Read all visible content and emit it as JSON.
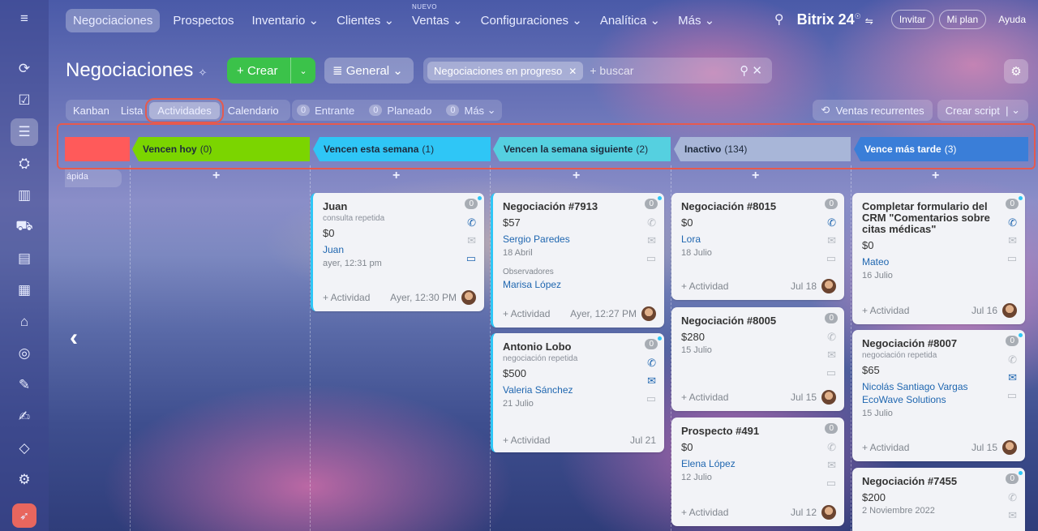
{
  "topnav": {
    "items": [
      "Negociaciones",
      "Prospectos",
      "Inventario",
      "Clientes",
      "Ventas",
      "Configuraciones",
      "Analítica",
      "Más"
    ],
    "new_badge": "NUEVO",
    "brand": "Bitrix 24",
    "invite": "Invitar",
    "my_plan": "Mi plan",
    "help": "Ayuda"
  },
  "header": {
    "title": "Negociaciones",
    "create": "Crear",
    "general": "General",
    "filter_chip": "Negociaciones en progreso",
    "search_placeholder": "buscar"
  },
  "views": {
    "kanban": "Kanban",
    "list": "Lista",
    "activities": "Actividades",
    "calendar": "Calendario"
  },
  "counters": [
    {
      "n": "0",
      "label": "Entrante"
    },
    {
      "n": "0",
      "label": "Planeado"
    },
    {
      "n": "0",
      "label": "Más"
    }
  ],
  "right_buttons": {
    "recurring": "Ventas recurrentes",
    "script": "Crear script"
  },
  "stages": [
    {
      "name": "Vencen hoy",
      "count": "(0)"
    },
    {
      "name": "Vencen esta semana",
      "count": "(1)"
    },
    {
      "name": "Vencen la semana siguiente",
      "count": "(2)"
    },
    {
      "name": "Inactivo",
      "count": "(134)"
    },
    {
      "name": "Vence más tarde",
      "count": "(3)"
    }
  ],
  "quick": "ápida",
  "colors": {
    "accent_green": "#3bc24a",
    "stage_red": "#ff5a5a",
    "stage_today": "#7bd500",
    "stage_week": "#2fc6f6",
    "stage_next": "#55d0e0",
    "stage_inactive": "#a8b6d8",
    "stage_later": "#3a7ed8",
    "highlight": "#e65a4e"
  },
  "cards": {
    "week": [
      {
        "title": "Juan",
        "sub": "consulta repetida",
        "sum": "$0",
        "contact": "Juan",
        "date": "ayer, 12:31 pm",
        "add": "+ Actividad",
        "time": "Ayer, 12:30 PM"
      }
    ],
    "next": [
      {
        "title": "Negociación #7913",
        "sum": "$57",
        "contact": "Sergio Paredes",
        "date": "18 Abril",
        "obs_label": "Observadores",
        "obs": "Marisa López",
        "add": "+ Actividad",
        "time": "Ayer, 12:27 PM"
      },
      {
        "title": "Antonio Lobo",
        "sub": "negociación repetida",
        "sum": "$500",
        "contact": "Valeria Sánchez",
        "date": "21 Julio",
        "add": "+ Actividad",
        "time": "Jul 21"
      }
    ],
    "inactive": [
      {
        "title": "Negociación #8015",
        "sum": "$0",
        "contact": "Lora",
        "date": "18 Julio",
        "add": "+ Actividad",
        "time": "Jul 18"
      },
      {
        "title": "Negociación #8005",
        "sum": "$280",
        "date": "15 Julio",
        "add": "+ Actividad",
        "time": "Jul 15"
      },
      {
        "title": "Prospecto #491",
        "sum": "$0",
        "contact": "Elena López",
        "date": "12 Julio",
        "add": "+ Actividad",
        "time": "Jul 12"
      }
    ],
    "later": [
      {
        "title": "Completar formulario del CRM \"Comentarios sobre citas médicas\"",
        "sum": "$0",
        "contact": "Mateo",
        "date": "16 Julio",
        "add": "+ Actividad",
        "time": "Jul 16"
      },
      {
        "title": "Negociación #8007",
        "sub": "negociación repetida",
        "sum": "$65",
        "contact": "Nicolás Santiago Vargas",
        "contact2": "EcoWave Solutions",
        "date": "15 Julio",
        "add": "+ Actividad",
        "time": "Jul 15"
      },
      {
        "title": "Negociación #7455",
        "sum": "$200",
        "date": "2 Noviembre 2022"
      }
    ]
  },
  "badge_zero": "0"
}
